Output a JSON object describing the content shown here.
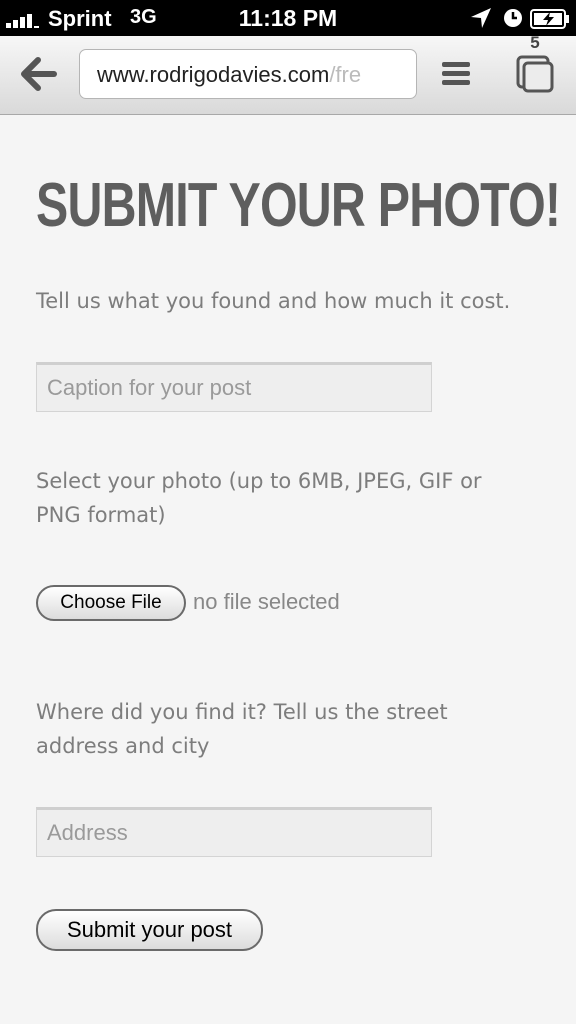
{
  "status_bar": {
    "carrier": "Sprint",
    "network": "3G",
    "time": "11:18 PM"
  },
  "browser": {
    "url_main": "www.rodrigodavies.com",
    "url_faded": "/fre",
    "tab_count": "5"
  },
  "page": {
    "title": "SUBMIT YOUR PHOTO!",
    "caption_prompt": "Tell us what you found and how much it cost.",
    "caption_placeholder": "Caption for your post",
    "photo_prompt": "Select your photo (up to 6MB, JPEG, GIF or PNG format)",
    "choose_file_label": "Choose File",
    "file_status": "no file selected",
    "address_prompt": "Where did you find it? Tell us the street address and city",
    "address_placeholder": "Address",
    "submit_label": "Submit your post"
  },
  "icons": [
    "signal-icon",
    "location-arrow-icon",
    "alarm-clock-icon",
    "battery-charging-icon",
    "back-arrow-icon",
    "menu-icon",
    "tabs-icon"
  ],
  "colors": {
    "title": "#5e5e5e",
    "body_text": "#7d7d7d",
    "page_background": "#f5f5f5"
  }
}
